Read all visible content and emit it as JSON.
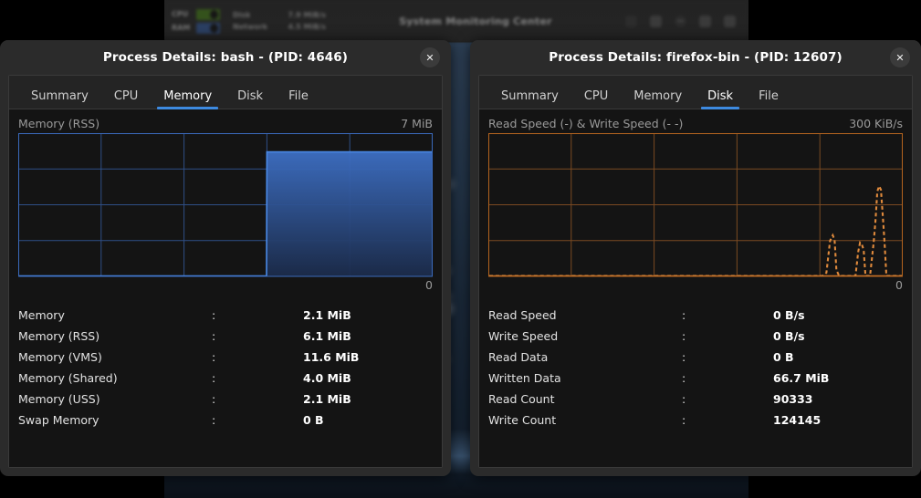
{
  "desktop": {
    "background_app": {
      "title": "System Monitoring Center",
      "meters": [
        {
          "label": "CPU",
          "color": "#4f8a1f"
        },
        {
          "label": "RAM",
          "color": "#3c63a8"
        }
      ],
      "stats": [
        {
          "label": "Disk",
          "value": "7.9 MiB/s"
        },
        {
          "label": "Network",
          "value": "4.5 MiB/s"
        }
      ],
      "toolbar_icons": [
        "performance-icon",
        "processes-icon",
        "users-icon",
        "services-icon",
        "settings-icon"
      ]
    }
  },
  "windows": [
    {
      "id": "left",
      "title": "Process Details: bash - (PID: 4646)",
      "close_label": "✕",
      "close_icon": "close-icon",
      "tabs": [
        {
          "label": "Summary",
          "active": false
        },
        {
          "label": "CPU",
          "active": false
        },
        {
          "label": "Memory",
          "active": true
        },
        {
          "label": "Disk",
          "active": false
        },
        {
          "label": "File",
          "active": false
        }
      ],
      "graph": {
        "title": "Memory (RSS)",
        "max_label": "7 MiB",
        "min_label": "0",
        "accent": "#3d78d8"
      },
      "stats": [
        {
          "name": "Memory",
          "colon": ":",
          "value": "2.1 MiB"
        },
        {
          "name": "Memory (RSS)",
          "colon": ":",
          "value": "6.1 MiB"
        },
        {
          "name": "Memory (VMS)",
          "colon": ":",
          "value": "11.6 MiB"
        },
        {
          "name": "Memory (Shared)",
          "colon": ":",
          "value": "4.0 MiB"
        },
        {
          "name": "Memory (USS)",
          "colon": ":",
          "value": "2.1 MiB"
        },
        {
          "name": "Swap Memory",
          "colon": ":",
          "value": "0 B"
        }
      ]
    },
    {
      "id": "right",
      "title": "Process Details: firefox-bin - (PID: 12607)",
      "close_label": "✕",
      "close_icon": "close-icon",
      "tabs": [
        {
          "label": "Summary",
          "active": false
        },
        {
          "label": "CPU",
          "active": false
        },
        {
          "label": "Memory",
          "active": false
        },
        {
          "label": "Disk",
          "active": true
        },
        {
          "label": "File",
          "active": false
        }
      ],
      "graph": {
        "title": "Read Speed (-) & Write Speed (-  -)",
        "max_label": "300 KiB/s",
        "min_label": "0",
        "accent": "#d1762a"
      },
      "stats": [
        {
          "name": "Read Speed",
          "colon": ":",
          "value": "0 B/s"
        },
        {
          "name": "Write Speed",
          "colon": ":",
          "value": "0 B/s"
        },
        {
          "name": "Read Data",
          "colon": ":",
          "value": "0 B"
        },
        {
          "name": "Written Data",
          "colon": ":",
          "value": "66.7 MiB"
        },
        {
          "name": "Read Count",
          "colon": ":",
          "value": "90333"
        },
        {
          "name": "Write Count",
          "colon": ":",
          "value": "124145"
        }
      ]
    }
  ],
  "chart_data": [
    {
      "type": "area",
      "title": "Memory (RSS)",
      "xlabel": "",
      "ylabel": "MiB",
      "ylim": [
        0,
        7
      ],
      "ytick_labels": [
        "7 MiB",
        "0"
      ],
      "grid": {
        "columns": 5,
        "rows": 4
      },
      "legend": [],
      "series": [
        {
          "name": "Memory (RSS)",
          "color": "#3d78d8",
          "x": [
            0,
            10,
            20,
            30,
            40,
            50,
            59,
            60,
            61,
            70,
            80,
            90,
            100
          ],
          "values": [
            0,
            0,
            0,
            0,
            0,
            0,
            0,
            6.1,
            6.1,
            6.1,
            6.1,
            6.1,
            6.1
          ]
        }
      ]
    },
    {
      "type": "line",
      "title": "Read Speed (-) & Write Speed (-  -)",
      "xlabel": "",
      "ylabel": "KiB/s",
      "ylim": [
        0,
        300
      ],
      "ytick_labels": [
        "300 KiB/s",
        "0"
      ],
      "grid": {
        "columns": 5,
        "rows": 4
      },
      "legend": [
        {
          "name": "Read Speed",
          "style": "solid",
          "color": "#d1762a"
        },
        {
          "name": "Write Speed",
          "style": "dashed",
          "color": "#d1762a"
        }
      ],
      "series": [
        {
          "name": "Read Speed",
          "color": "#d1762a",
          "style": "solid",
          "x": [
            0,
            20,
            40,
            60,
            80,
            100
          ],
          "values": [
            0,
            0,
            0,
            0,
            0,
            0
          ]
        },
        {
          "name": "Write Speed",
          "color": "#d1762a",
          "style": "dashed",
          "x": [
            0,
            74,
            78,
            80,
            82,
            86,
            88,
            90,
            92,
            94,
            96,
            98,
            100
          ],
          "values": [
            0,
            0,
            0,
            105,
            0,
            0,
            98,
            0,
            0,
            185,
            0,
            0,
            0
          ]
        }
      ]
    }
  ]
}
